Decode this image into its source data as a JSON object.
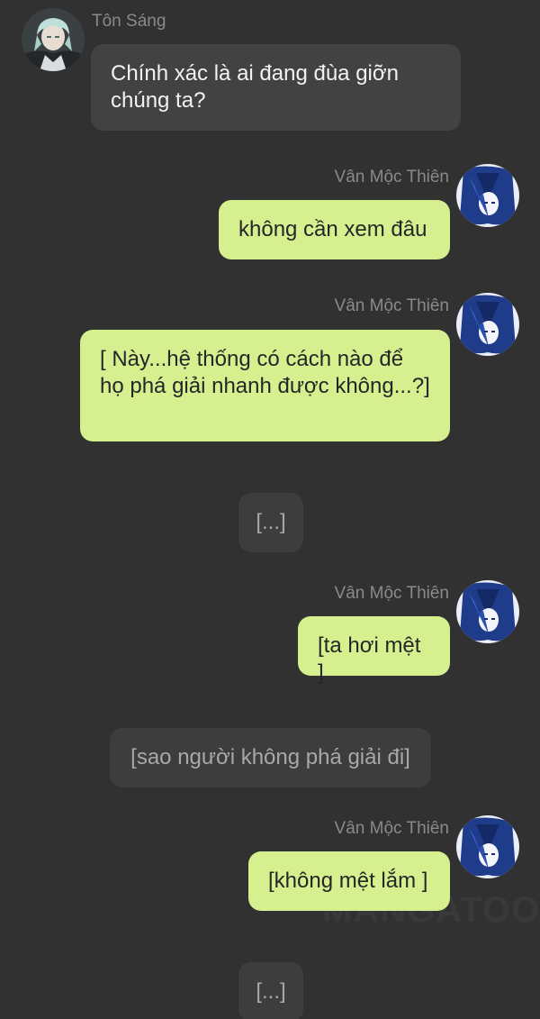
{
  "messages": {
    "m1": {
      "sender": "Tôn Sáng",
      "text": "Chính xác là ai đang đùa giỡn chúng ta?"
    },
    "m2": {
      "sender": "Vân Mộc Thiên",
      "text": "không cần xem đâu"
    },
    "m3": {
      "sender": "Vân Mộc Thiên",
      "text": "[ Này...hệ thống có cách nào để họ phá giải nhanh được không...?]"
    },
    "m4": {
      "text": "[...]"
    },
    "m5": {
      "sender": "Vân Mộc Thiên",
      "text": "[ta hơi mệt ]"
    },
    "m6": {
      "text": "[sao người không phá giải đi]"
    },
    "m7": {
      "sender": "Vân Mộc Thiên",
      "text": "[không mệt lắm ]"
    },
    "m8": {
      "text": "[...]"
    }
  },
  "watermark": "MANGATOON",
  "colors": {
    "background": "#313131",
    "incoming_bubble": "#424242",
    "outgoing_bubble": "#d6f08f",
    "system_bubble": "#3d3d3d"
  }
}
